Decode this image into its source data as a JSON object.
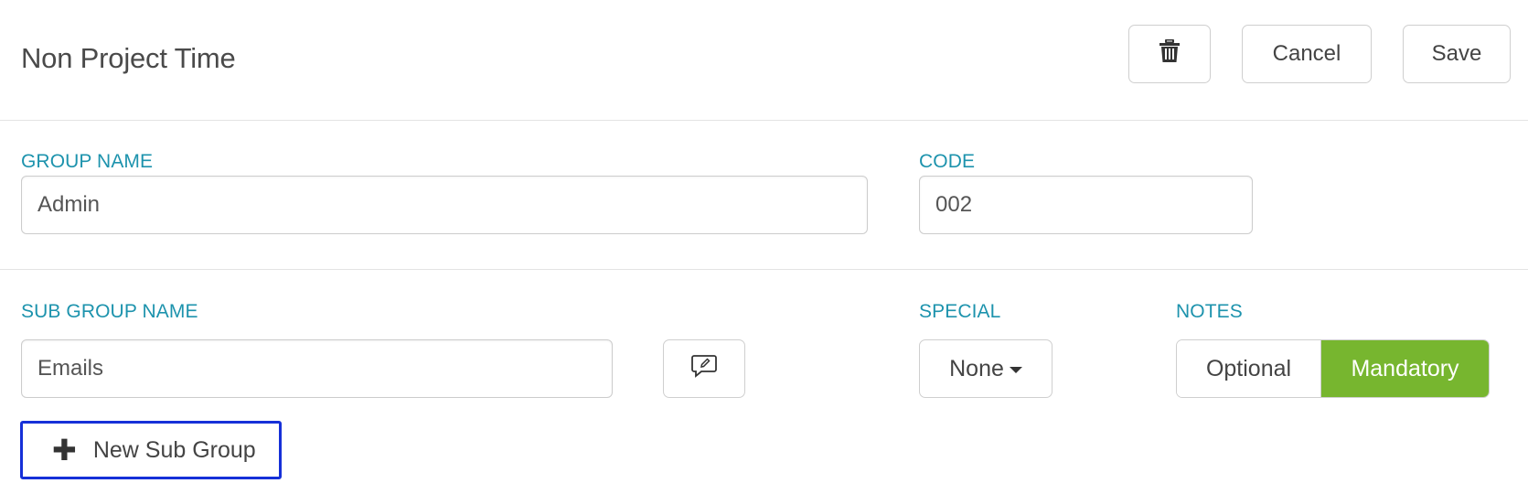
{
  "header": {
    "title": "Non Project Time",
    "delete_icon": "trash-icon",
    "cancel_label": "Cancel",
    "save_label": "Save"
  },
  "group": {
    "name_label": "GROUP NAME",
    "name_value": "Admin",
    "code_label": "CODE",
    "code_value": "002"
  },
  "sub_group": {
    "name_label": "SUB GROUP NAME",
    "name_value": "Emails",
    "note_icon": "comment-edit-icon",
    "special_label": "SPECIAL",
    "special_value": "None",
    "notes_label": "NOTES",
    "notes_options": [
      "Optional",
      "Mandatory"
    ],
    "notes_selected": "Mandatory",
    "new_button_label": "New Sub Group",
    "new_button_icon": "plus-icon"
  },
  "colors": {
    "label_accent": "#1d93ad",
    "selected_toggle": "#77b62f",
    "focus_outline": "#1630d8"
  }
}
